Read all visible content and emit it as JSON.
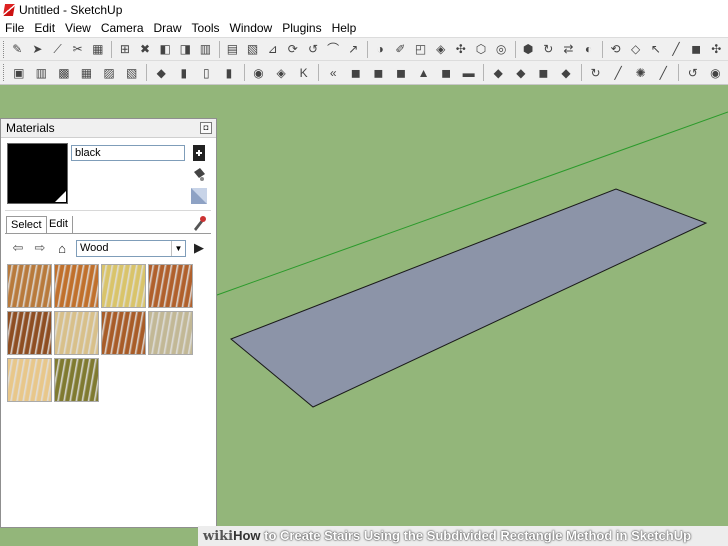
{
  "window": {
    "title": "Untitled - SketchUp"
  },
  "menu": [
    "File",
    "Edit",
    "View",
    "Camera",
    "Draw",
    "Tools",
    "Window",
    "Plugins",
    "Help"
  ],
  "materials_panel": {
    "title": "Materials",
    "close_glyph": "◘",
    "material_name": "black",
    "selected_color": "#000000",
    "tabs": [
      "Select",
      "Edit"
    ],
    "library": "Wood",
    "textures": [
      {
        "name": "wood-1",
        "color": "#b87a3c"
      },
      {
        "name": "wood-2",
        "color": "#c0702c"
      },
      {
        "name": "wood-3",
        "color": "#d9c46a"
      },
      {
        "name": "wood-4",
        "color": "#b0602c"
      },
      {
        "name": "wood-5",
        "color": "#8e4e22"
      },
      {
        "name": "wood-6",
        "color": "#d8c08a"
      },
      {
        "name": "wood-7",
        "color": "#a85c28"
      },
      {
        "name": "wood-8",
        "color": "#c2b896"
      },
      {
        "name": "wood-9",
        "color": "#e8c78a"
      },
      {
        "name": "wood-10",
        "color": "#7f7a30"
      }
    ]
  },
  "toolbar_row1": [
    "✎",
    "➤",
    "⟋",
    "✂",
    "▦",
    "⊞",
    "✖",
    "◧",
    "◨",
    "▥",
    "▤",
    "▧",
    "⊿",
    "⟳",
    "↺",
    "⌒",
    "↗",
    "◑",
    "✐",
    "◰",
    "◈",
    "✣",
    "⬡",
    "◎",
    "⬢",
    "↻",
    "⇄",
    "◐",
    "⟲",
    "◇",
    "↖",
    "╱",
    "◼",
    "✣"
  ],
  "toolbar_row2": [
    "▣",
    "▥",
    "▩",
    "▦",
    "▨",
    "▧",
    "◆",
    "▮",
    "▯",
    "▮",
    "◉",
    "◈",
    "K",
    "«",
    "◼",
    "◼",
    "◼",
    "▲",
    "◼",
    "▬",
    "◆",
    "◆",
    "◼",
    "◆",
    "↻",
    "╱",
    "✺",
    "╱",
    "↺",
    "◉"
  ],
  "watermark": {
    "wiki": "wiki",
    "how": "How",
    "rest": " to Create Stairs Using the Subdivided Rectangle Method in SketchUp"
  },
  "colors": {
    "ground": "#93b67a",
    "rectangle_fill": "#8c94a8",
    "axis_green": "#2b9a2b"
  }
}
